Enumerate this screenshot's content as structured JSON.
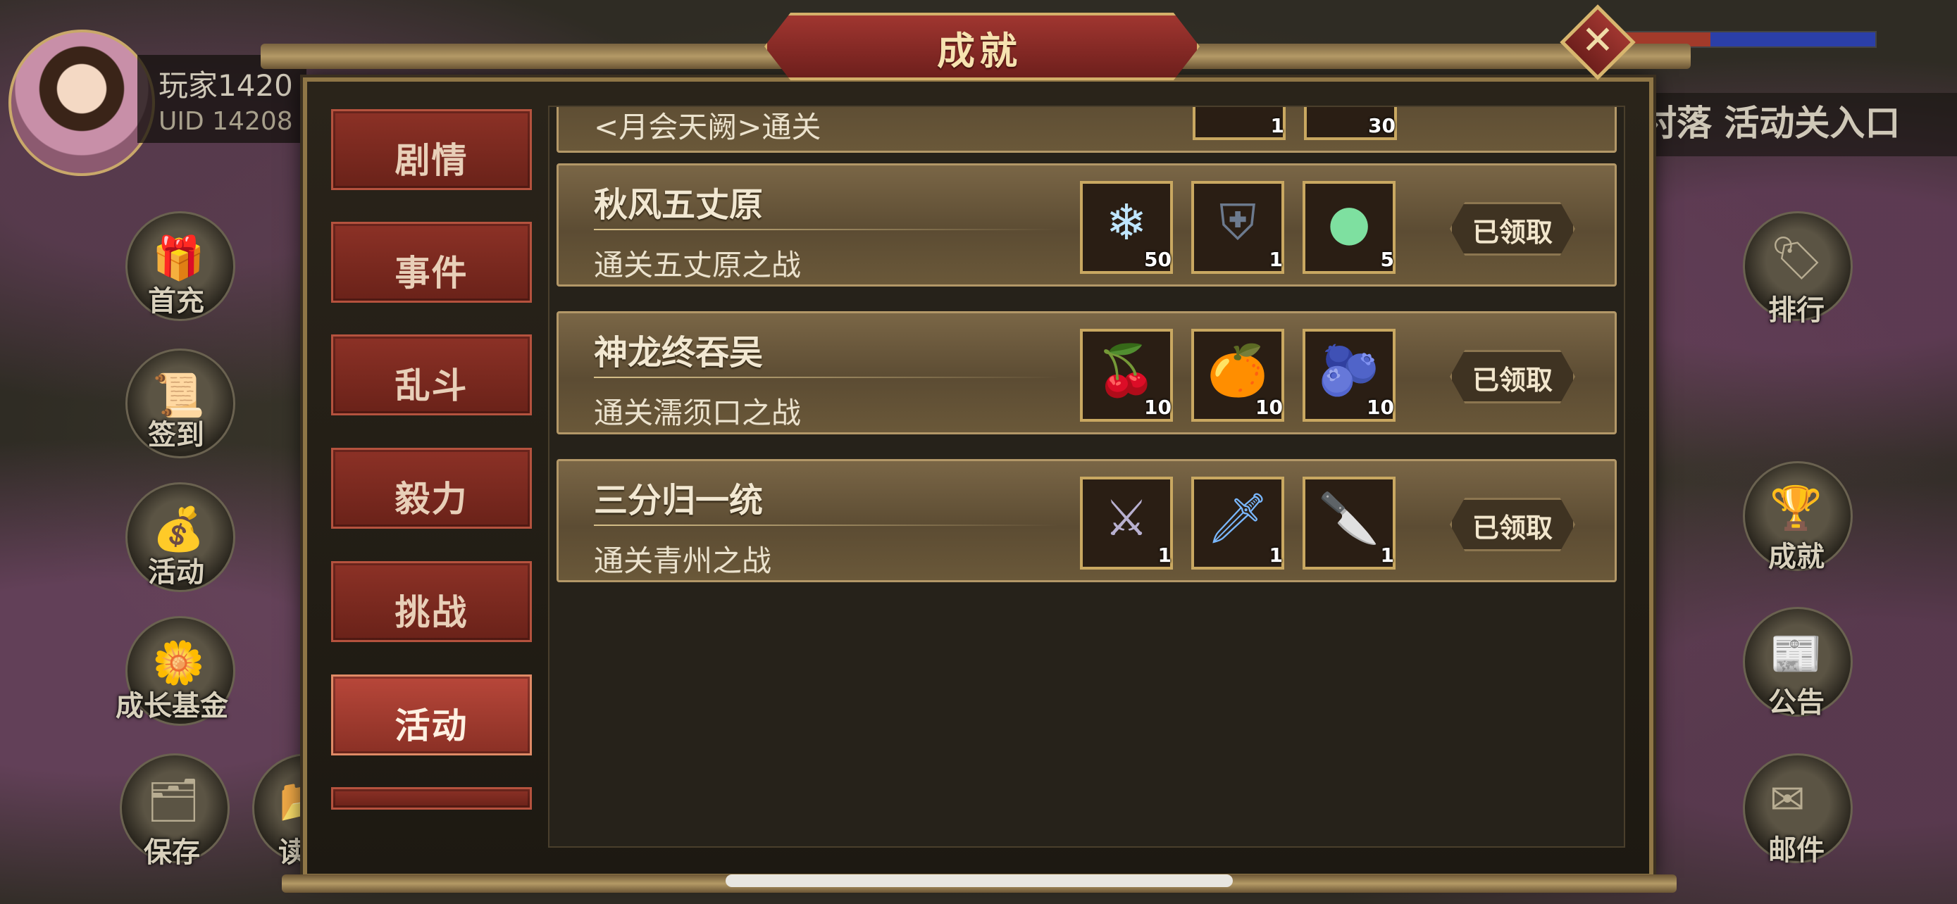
{
  "hud": {
    "player_name": "玩家1420",
    "player_uid": "UID  14208",
    "banner": "村落 活动关入口",
    "left_menu": [
      {
        "label": "首充",
        "icon": "gift-icon"
      },
      {
        "label": "签到",
        "icon": "scroll-icon"
      },
      {
        "label": "活动",
        "icon": "treasure-icon"
      },
      {
        "label": "成长基金",
        "icon": "flower-icon"
      },
      {
        "label": "保存",
        "icon": "save-icon"
      },
      {
        "label": "读",
        "icon": "load-icon"
      }
    ],
    "right_menu": [
      {
        "label": "排行",
        "icon": "ranking-icon"
      },
      {
        "label": "成就",
        "icon": "achievement-icon"
      },
      {
        "label": "公告",
        "icon": "notice-icon"
      },
      {
        "label": "邮件",
        "icon": "mail-icon"
      }
    ]
  },
  "dialog": {
    "title": "成就",
    "close_icon": "close-icon",
    "tabs": [
      {
        "label": "剧情",
        "active": false
      },
      {
        "label": "事件",
        "active": false
      },
      {
        "label": "乱斗",
        "active": false
      },
      {
        "label": "毅力",
        "active": false
      },
      {
        "label": "挑战",
        "active": false
      },
      {
        "label": "活动",
        "active": true
      }
    ],
    "partial_row": {
      "title": "<月会天阙>通关",
      "item_counts": [
        "1",
        "30"
      ]
    },
    "achievements": [
      {
        "title": "秋风五丈原",
        "desc": "通关五丈原之战",
        "button": "已领取",
        "rewards": [
          {
            "icon": "ice-crystal-icon",
            "count": "50"
          },
          {
            "icon": "armor-icon",
            "count": "1"
          },
          {
            "icon": "rainbow-orb-icon",
            "count": "5"
          }
        ]
      },
      {
        "title": "神龙终吞吴",
        "desc": "通关濡须口之战",
        "button": "已领取",
        "rewards": [
          {
            "icon": "red-fruit-icon",
            "count": "10"
          },
          {
            "icon": "orange-fruit-icon",
            "count": "10"
          },
          {
            "icon": "blue-fruit-icon",
            "count": "10"
          }
        ]
      },
      {
        "title": "三分归一统",
        "desc": "通关青州之战",
        "button": "已领取",
        "rewards": [
          {
            "icon": "spear-icon",
            "count": "1"
          },
          {
            "icon": "sword-icon",
            "count": "1"
          },
          {
            "icon": "blade-icon",
            "count": "1"
          }
        ]
      }
    ]
  },
  "colors": {
    "gold_border": "#c9a861",
    "tab_red": "#8c3126",
    "row_brown": "#6a5839"
  }
}
